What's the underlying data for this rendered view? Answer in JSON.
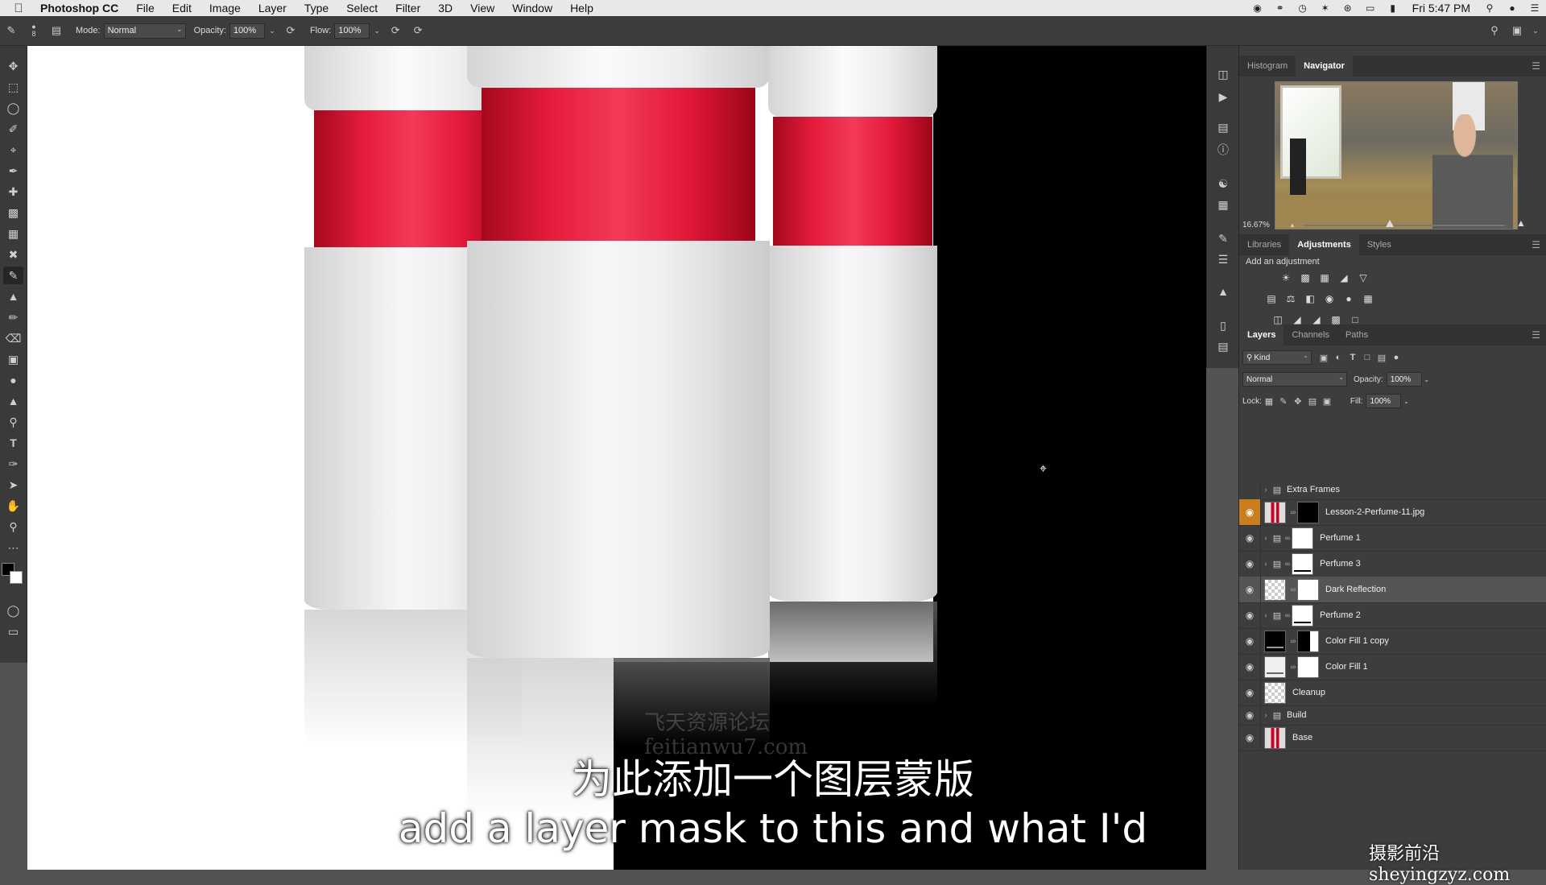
{
  "menubar": {
    "app": "Photoshop CC",
    "items": [
      "File",
      "Edit",
      "Image",
      "Layer",
      "Type",
      "Select",
      "Filter",
      "3D",
      "View",
      "Window",
      "Help"
    ],
    "clock": "Fri 5:47 PM"
  },
  "options": {
    "brush_size": "8",
    "mode_label": "Mode:",
    "mode_value": "Normal",
    "opacity_label": "Opacity:",
    "opacity_value": "100%",
    "flow_label": "Flow:",
    "flow_value": "100%"
  },
  "navigator": {
    "tabs": [
      "Histogram",
      "Navigator"
    ],
    "zoom": "16.67%"
  },
  "adjustments": {
    "tabs": [
      "Libraries",
      "Adjustments",
      "Styles"
    ],
    "title": "Add an adjustment"
  },
  "layers_panel": {
    "tabs": [
      "Layers",
      "Channels",
      "Paths"
    ],
    "filter_kind": "Kind",
    "blend_mode": "Normal",
    "opacity_label": "Opacity:",
    "opacity_value": "100%",
    "lock_label": "Lock:",
    "fill_label": "Fill:",
    "fill_value": "100%",
    "layers": [
      {
        "name": "Extra Frames"
      },
      {
        "name": "Lesson-2-Perfume-11.jpg"
      },
      {
        "name": "Perfume 1"
      },
      {
        "name": "Perfume 3"
      },
      {
        "name": "Dark Reflection"
      },
      {
        "name": "Perfume 2"
      },
      {
        "name": "Color Fill 1 copy"
      },
      {
        "name": "Color Fill 1"
      },
      {
        "name": "Cleanup"
      },
      {
        "name": "Build"
      },
      {
        "name": "Base"
      }
    ]
  },
  "canvas": {
    "watermark_line1": "飞天资源论坛",
    "watermark_line2": "feitianwu7.com",
    "subtitle_cn": "为此添加一个图层蒙版",
    "subtitle_en": "add a layer mask to this and what I'd",
    "corner_logo": "摄影前沿 sheyingzyz.com"
  }
}
